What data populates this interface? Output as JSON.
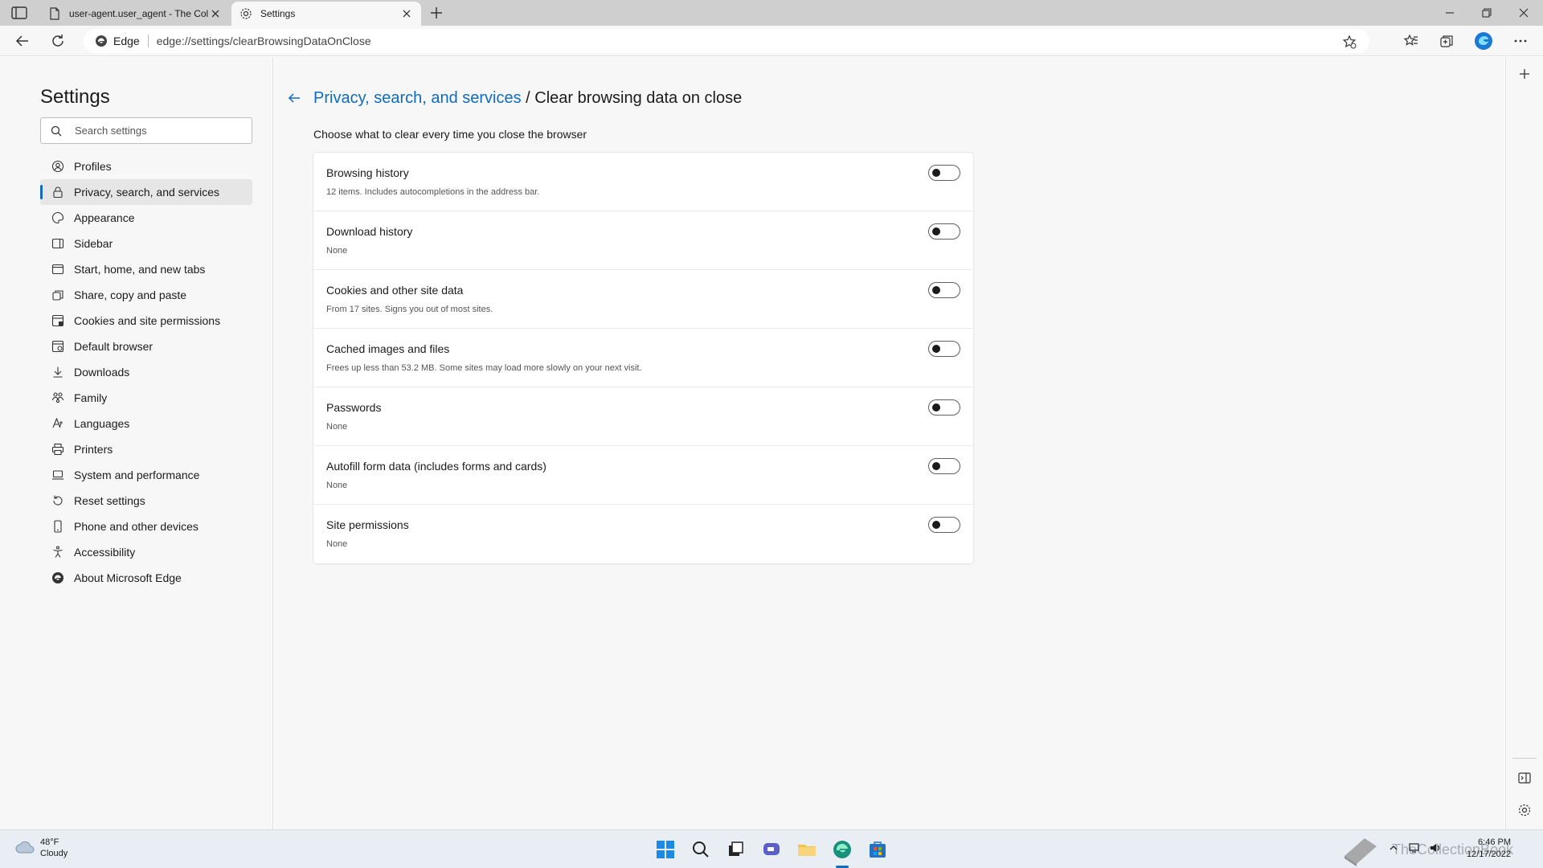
{
  "tabs": [
    {
      "label": "user-agent.user_agent - The Coll",
      "active": false
    },
    {
      "label": "Settings",
      "active": true
    }
  ],
  "address_bar": {
    "brand": "Edge",
    "url": "edge://settings/clearBrowsingDataOnClose"
  },
  "sidebar": {
    "title": "Settings",
    "search_placeholder": "Search settings",
    "items": [
      {
        "label": "Profiles",
        "icon": "profile-icon"
      },
      {
        "label": "Privacy, search, and services",
        "icon": "lock-icon",
        "selected": true
      },
      {
        "label": "Appearance",
        "icon": "appearance-icon"
      },
      {
        "label": "Sidebar",
        "icon": "sidebar-icon"
      },
      {
        "label": "Start, home, and new tabs",
        "icon": "home-icon"
      },
      {
        "label": "Share, copy and paste",
        "icon": "share-icon"
      },
      {
        "label": "Cookies and site permissions",
        "icon": "cookies-icon"
      },
      {
        "label": "Default browser",
        "icon": "browser-icon"
      },
      {
        "label": "Downloads",
        "icon": "download-icon"
      },
      {
        "label": "Family",
        "icon": "family-icon"
      },
      {
        "label": "Languages",
        "icon": "languages-icon"
      },
      {
        "label": "Printers",
        "icon": "printer-icon"
      },
      {
        "label": "System and performance",
        "icon": "laptop-icon"
      },
      {
        "label": "Reset settings",
        "icon": "reset-icon"
      },
      {
        "label": "Phone and other devices",
        "icon": "phone-icon"
      },
      {
        "label": "Accessibility",
        "icon": "accessibility-icon"
      },
      {
        "label": "About Microsoft Edge",
        "icon": "edge-logo-icon"
      }
    ]
  },
  "main": {
    "breadcrumb_link": "Privacy, search, and services",
    "breadcrumb_separator": " / ",
    "page_title": "Clear browsing data on close",
    "subtitle": "Choose what to clear every time you close the browser",
    "rows": [
      {
        "label": "Browsing history",
        "description": "12 items. Includes autocompletions in the address bar.",
        "enabled": false
      },
      {
        "label": "Download history",
        "description": "None",
        "enabled": false
      },
      {
        "label": "Cookies and other site data",
        "description": "From 17 sites. Signs you out of most sites.",
        "enabled": false
      },
      {
        "label": "Cached images and files",
        "description": "Frees up less than 53.2 MB. Some sites may load more slowly on your next visit.",
        "enabled": false
      },
      {
        "label": "Passwords",
        "description": "None",
        "enabled": false
      },
      {
        "label": "Autofill form data (includes forms and cards)",
        "description": "None",
        "enabled": false
      },
      {
        "label": "Site permissions",
        "description": "None",
        "enabled": false
      }
    ]
  },
  "taskbar": {
    "weather_temp": "48°F",
    "weather_desc": "Cloudy",
    "time": "6:46 PM",
    "date": "12/17/2022",
    "watermark": "TheCollectionBook"
  },
  "colors": {
    "accent": "#0f6cbd",
    "panel_bg": "#f7f7f7",
    "card_bg": "#ffffff"
  }
}
